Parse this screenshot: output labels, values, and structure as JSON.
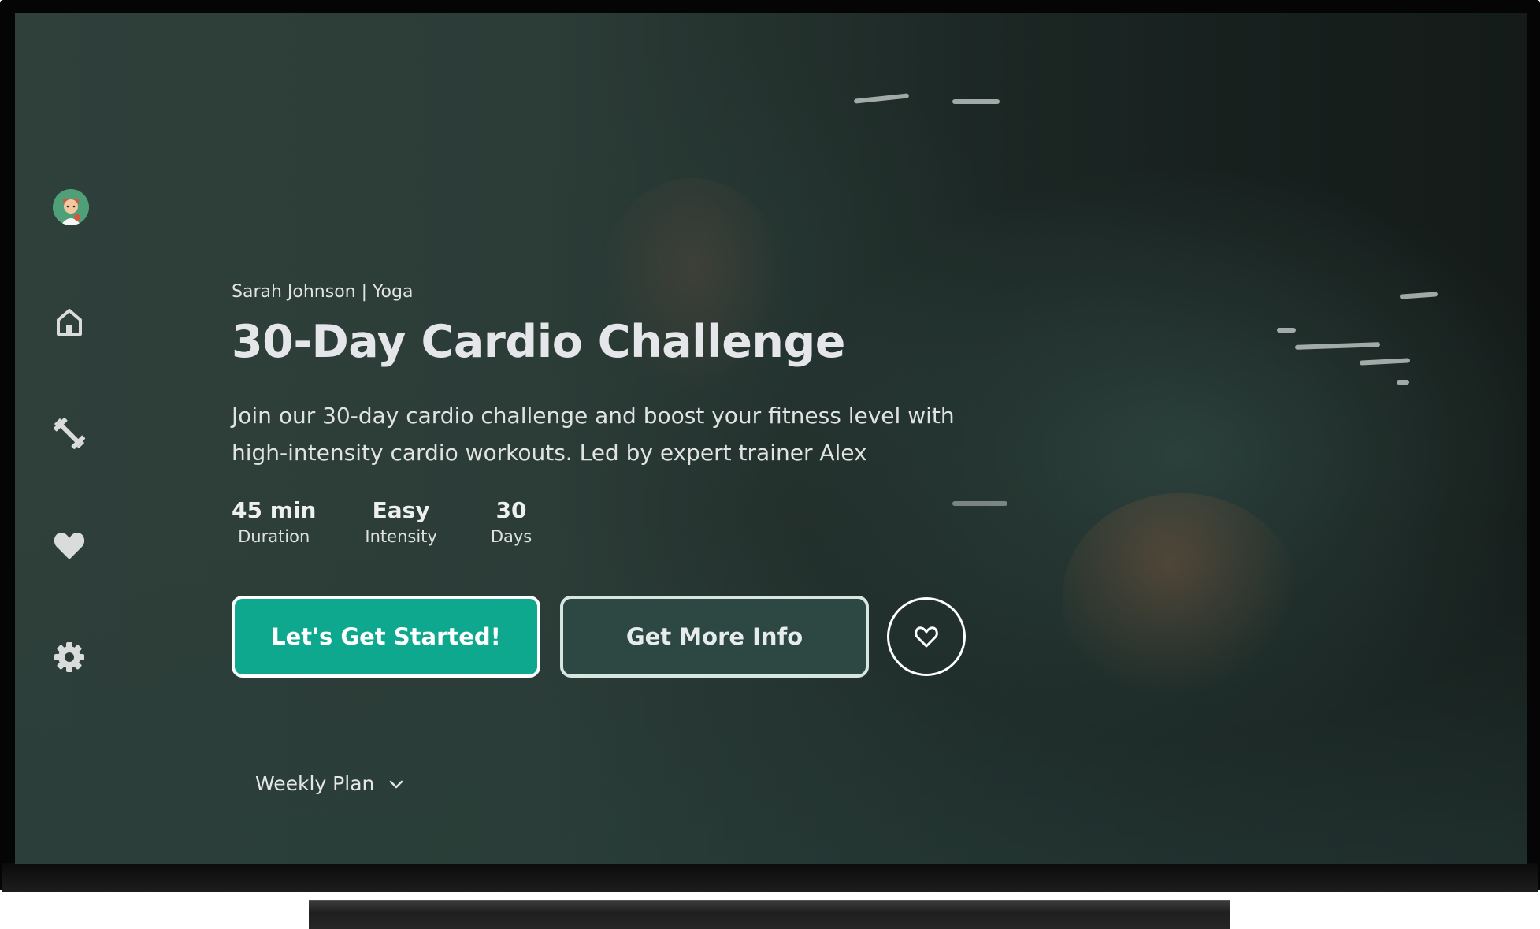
{
  "hero": {
    "subtitle": "Sarah Johnson | Yoga",
    "title": "30-Day Cardio Challenge",
    "description": "Join our 30-day cardio challenge and boost your fitness level with high-intensity cardio workouts. Led by expert trainer Alex",
    "stats": [
      {
        "value": "45 min",
        "label": "Duration"
      },
      {
        "value": "Easy",
        "label": "Intensity"
      },
      {
        "value": "30",
        "label": "Days"
      }
    ],
    "primary_button": "Let's Get Started!",
    "secondary_button": "Get More Info",
    "favorite_icon": "heart-outline-icon"
  },
  "weekly_plan": {
    "label": "Weekly Plan",
    "icon": "chevron-down-icon"
  },
  "nav": {
    "items": [
      {
        "icon": "avatar"
      },
      {
        "icon": "home-icon"
      },
      {
        "icon": "dumbbell-icon"
      },
      {
        "icon": "heart-icon"
      },
      {
        "icon": "gear-icon"
      }
    ]
  },
  "colors": {
    "accent": "#0ea88f",
    "secondary_button_bg": "#2d4842",
    "background": "#2b3b36"
  }
}
